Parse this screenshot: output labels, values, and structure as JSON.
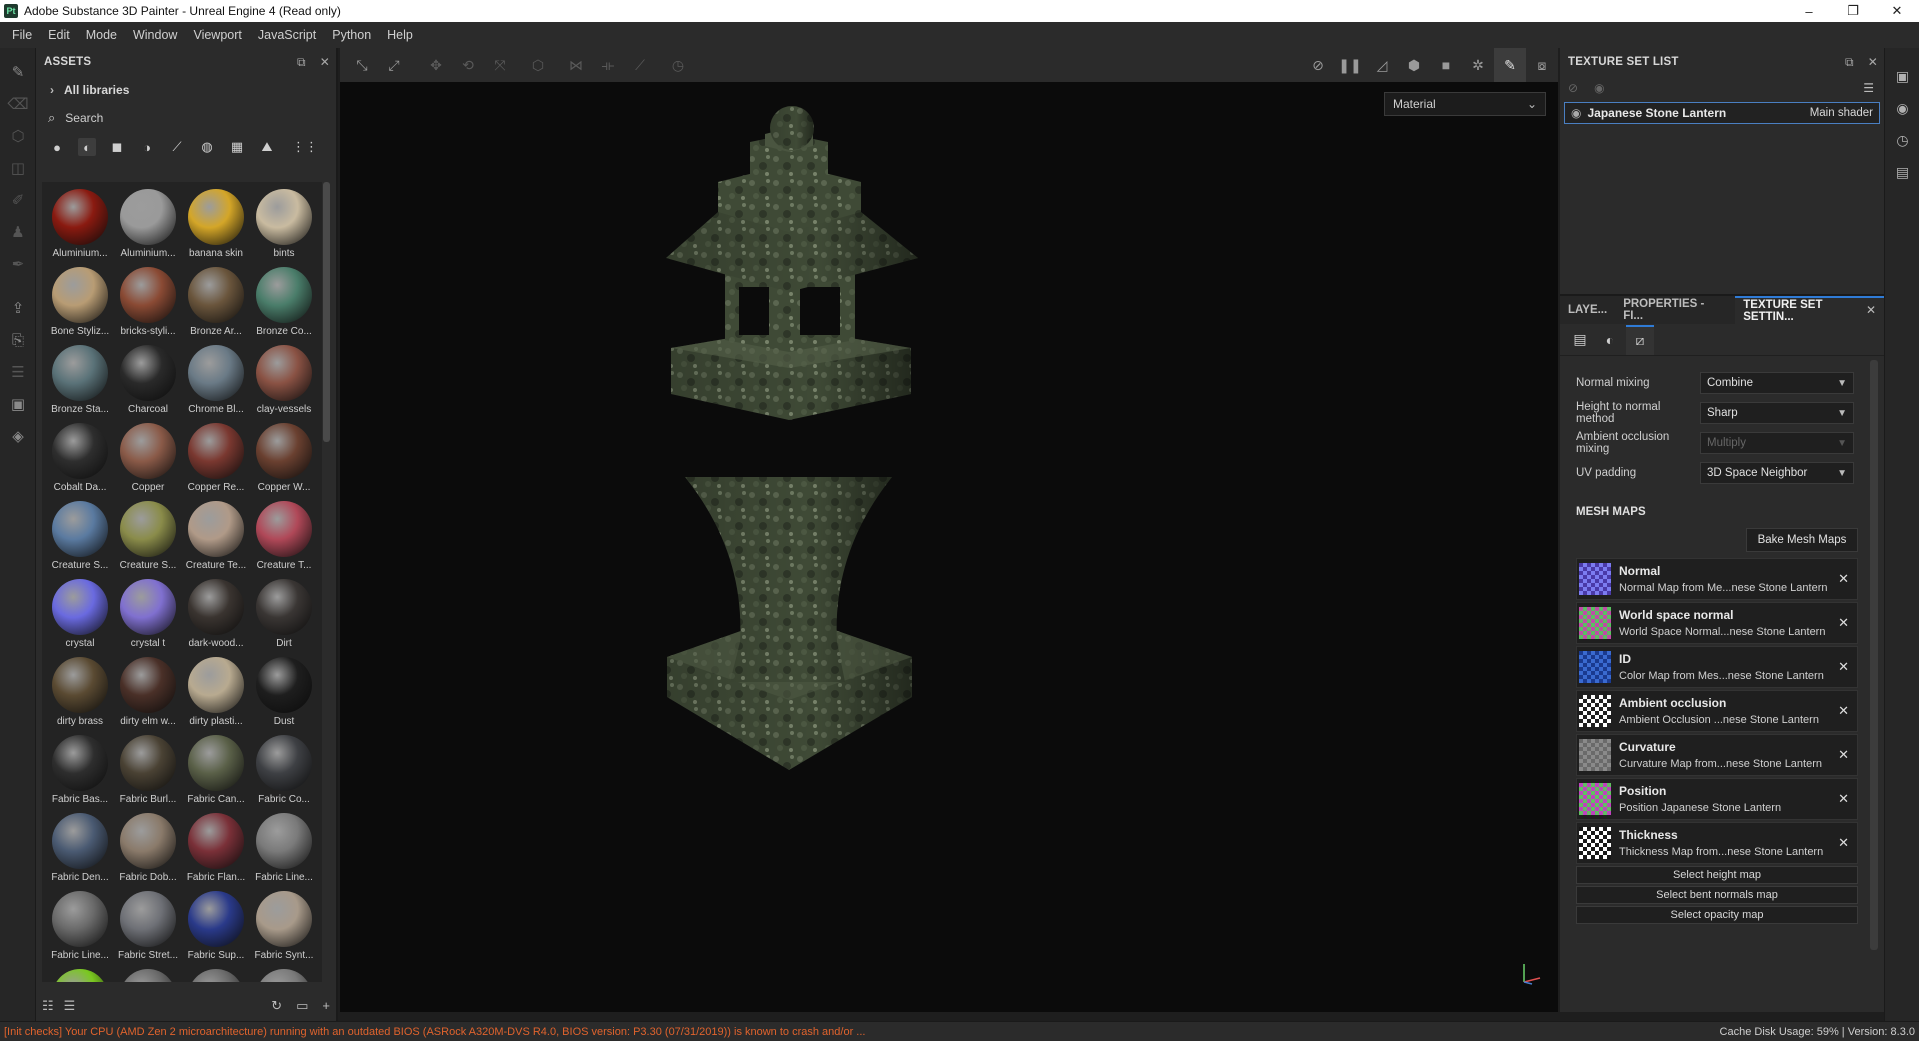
{
  "titlebar": {
    "app_icon": "Pt",
    "title": "Adobe Substance 3D Painter - Unreal Engine 4 (Read only)",
    "minimize": "–",
    "restore": "❐",
    "close": "✕"
  },
  "menubar": {
    "items": [
      "File",
      "Edit",
      "Mode",
      "Window",
      "Viewport",
      "JavaScript",
      "Python",
      "Help"
    ]
  },
  "assets": {
    "title": "ASSETS",
    "libraries": "All libraries",
    "search_placeholder": "Search",
    "items": [
      {
        "name": "Aluminium...",
        "color": "#8a1a10"
      },
      {
        "name": "Aluminium...",
        "color": "#9a9a9a"
      },
      {
        "name": "banana skin",
        "color": "#d4a628"
      },
      {
        "name": "bints",
        "color": "#c9bba0"
      },
      {
        "name": "Bone Styliz...",
        "color": "#b89c74"
      },
      {
        "name": "bricks-styli...",
        "color": "#8a4a34"
      },
      {
        "name": "Bronze Ar...",
        "color": "#6a553c"
      },
      {
        "name": "Bronze Co...",
        "color": "#4a7d6a"
      },
      {
        "name": "Bronze Sta...",
        "color": "#5a7278"
      },
      {
        "name": "Charcoal",
        "color": "#2a2a2a"
      },
      {
        "name": "Chrome Bl...",
        "color": "#6a7a86"
      },
      {
        "name": "clay-vessels",
        "color": "#8a5244"
      },
      {
        "name": "Cobalt Da...",
        "color": "#2e2e2e"
      },
      {
        "name": "Copper",
        "color": "#8a5a48"
      },
      {
        "name": "Copper Re...",
        "color": "#7a3830"
      },
      {
        "name": "Copper W...",
        "color": "#6a4030"
      },
      {
        "name": "Creature S...",
        "color": "#5a7aa0"
      },
      {
        "name": "Creature S...",
        "color": "#8a8c4a"
      },
      {
        "name": "Creature Te...",
        "color": "#b09a88"
      },
      {
        "name": "Creature T...",
        "color": "#b04858"
      },
      {
        "name": "crystal",
        "color": "#6a6ae0"
      },
      {
        "name": "crystal t",
        "color": "#8070d0"
      },
      {
        "name": "dark-wood...",
        "color": "#3a3430"
      },
      {
        "name": "Dirt",
        "color": "#3a3634"
      },
      {
        "name": "dirty brass",
        "color": "#5a4a32"
      },
      {
        "name": "dirty elm w...",
        "color": "#4a3028"
      },
      {
        "name": "dirty plasti...",
        "color": "#b8aa90"
      },
      {
        "name": "Dust",
        "color": "#1e1e1e"
      },
      {
        "name": "Fabric Bas...",
        "color": "#2e2e2e"
      },
      {
        "name": "Fabric Burl...",
        "color": "#4a4234"
      },
      {
        "name": "Fabric Can...",
        "color": "#5a6048"
      },
      {
        "name": "Fabric Co...",
        "color": "#3e4044"
      },
      {
        "name": "Fabric Den...",
        "color": "#4a5a72"
      },
      {
        "name": "Fabric Dob...",
        "color": "#8a7a6a"
      },
      {
        "name": "Fabric Flan...",
        "color": "#7a3038"
      },
      {
        "name": "Fabric Line...",
        "color": "#7a7a7a"
      },
      {
        "name": "Fabric Line...",
        "color": "#6a6a6a"
      },
      {
        "name": "Fabric Stret...",
        "color": "#6e7076"
      },
      {
        "name": "Fabric Sup...",
        "color": "#2a3a8a"
      },
      {
        "name": "Fabric Synt...",
        "color": "#a89a8a"
      },
      {
        "name": "",
        "color": "#7ac820"
      },
      {
        "name": "",
        "color": "#6a6a6a"
      },
      {
        "name": "",
        "color": "#6a6a6a"
      },
      {
        "name": "",
        "color": "#7a7a7a"
      }
    ]
  },
  "viewport": {
    "mode_select": "Material"
  },
  "texture_set_list": {
    "title": "TEXTURE SET LIST",
    "set_name": "Japanese Stone Lantern",
    "shader": "Main shader"
  },
  "tabs": {
    "layers": "LAYE...",
    "properties": "PROPERTIES - FI...",
    "texture_set_settings": "TEXTURE SET SETTIN..."
  },
  "settings": {
    "normal_mixing_label": "Normal mixing",
    "normal_mixing_value": "Combine",
    "height_to_normal_label": "Height to normal method",
    "height_to_normal_value": "Sharp",
    "ao_mixing_label": "Ambient occlusion mixing",
    "ao_mixing_value": "Multiply",
    "uv_padding_label": "UV padding",
    "uv_padding_value": "3D Space Neighbor"
  },
  "mesh_maps": {
    "title": "MESH MAPS",
    "bake_button": "Bake Mesh Maps",
    "items": [
      {
        "title": "Normal",
        "subtitle": "Normal Map from Me...nese Stone Lantern"
      },
      {
        "title": "World space normal",
        "subtitle": "World Space Normal...nese Stone Lantern"
      },
      {
        "title": "ID",
        "subtitle": "Color Map from Mes...nese Stone Lantern"
      },
      {
        "title": "Ambient occlusion",
        "subtitle": "Ambient Occlusion ...nese Stone Lantern"
      },
      {
        "title": "Curvature",
        "subtitle": "Curvature Map from...nese Stone Lantern"
      },
      {
        "title": "Position",
        "subtitle": "Position Japanese Stone Lantern"
      },
      {
        "title": "Thickness",
        "subtitle": "Thickness Map from...nese Stone Lantern"
      }
    ],
    "select_height": "Select height map",
    "select_bent_normals": "Select bent normals map",
    "select_opacity": "Select opacity map"
  },
  "statusbar": {
    "warning": "[Init checks] Your CPU (AMD Zen 2 microarchitecture) running with an outdated BIOS (ASRock A320M-DVS R4.0, BIOS version: P3.30 (07/31/2019)) is known to crash and/or ...",
    "right": "Cache Disk Usage:  59% | Version: 8.3.0"
  },
  "colors": {
    "accent": "#2f7bd6",
    "warning": "#e0632d",
    "panel": "#2b2b2b",
    "viewport_bg": "#0b0b0b"
  }
}
